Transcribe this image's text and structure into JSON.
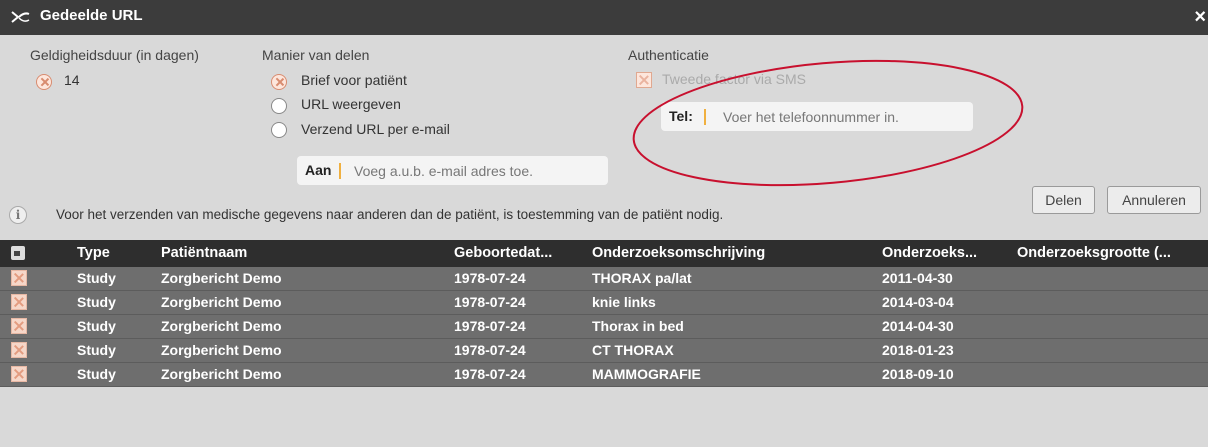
{
  "dialog": {
    "title": "Gedeelde URL",
    "close_symbol": "×"
  },
  "validity": {
    "heading": "Geldigheidsduur (in dagen)",
    "value": "14"
  },
  "share": {
    "heading": "Manier van delen",
    "options": [
      "Brief voor patiënt",
      "URL weergeven",
      "Verzend URL per e-mail"
    ],
    "selected": "Brief voor patiënt",
    "to_label": "Aan",
    "to_placeholder": "Voeg a.u.b. e-mail adres toe."
  },
  "auth": {
    "heading": "Authenticatie",
    "sms_label": "Tweede factor via SMS",
    "tel_label": "Tel:",
    "tel_placeholder": "Voer het telefoonnummer in."
  },
  "buttons": {
    "share": "Delen",
    "cancel": "Annuleren"
  },
  "notice": "Voor het verzenden van medische gegevens naar anderen dan de patiënt, is toestemming van de patiënt nodig.",
  "table": {
    "headers": [
      "Type",
      "Patiëntnaam",
      "Geboortedat...",
      "Onderzoeksomschrijving",
      "Onderzoeks...",
      "Onderzoeksgrootte (..."
    ],
    "rows": [
      [
        "Study",
        "Zorgbericht Demo",
        "1978-07-24",
        "THORAX pa/lat",
        "2011-04-30",
        ""
      ],
      [
        "Study",
        "Zorgbericht Demo",
        "1978-07-24",
        "knie links",
        "2014-03-04",
        ""
      ],
      [
        "Study",
        "Zorgbericht Demo",
        "1978-07-24",
        "Thorax in bed",
        "2014-04-30",
        ""
      ],
      [
        "Study",
        "Zorgbericht Demo",
        "1978-07-24",
        "CT THORAX",
        "2018-01-23",
        ""
      ],
      [
        "Study",
        "Zorgbericht Demo",
        "1978-07-24",
        "MAMMOGRAFIE",
        "2018-09-10",
        ""
      ]
    ]
  },
  "colors": {
    "titlebar": "#3c3c3c",
    "table_header": "#2e2e2e",
    "table_row": "#6e6e6e",
    "annotation_circle": "#c8102e",
    "input_accent": "#f0b040"
  },
  "icons": {
    "dialog_logo": "swoosh-logo-icon",
    "close": "close-icon",
    "info": "info-icon",
    "header": "select-all-icon",
    "row_check": "checkbox-x-icon"
  }
}
